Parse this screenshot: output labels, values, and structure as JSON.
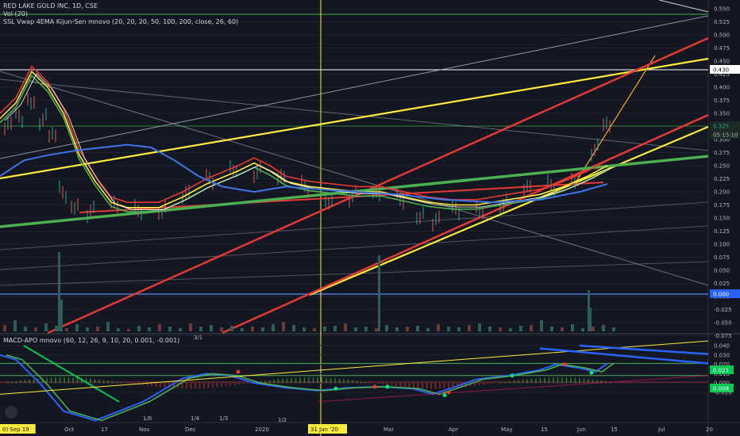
{
  "header": {
    "title": "RED LAKE GOLD INC, 1D, CSE",
    "vol_label": "Vol (20)",
    "indicator_label": "SSL Vwap 4EMA Kijun-Sen mnovo (20, 20, 20, 50, 100, 200, close, 26, 60)",
    "macd_label": "MACD-APO mnovo (60, 12, 26, 9, 10, 20, 0.001, -0.001)"
  },
  "price_axis": {
    "ticks": [
      "0.550",
      "0.525",
      "0.500",
      "0.475",
      "0.450",
      "0.425",
      "0.400",
      "0.375",
      "0.350",
      "0.325",
      "0.300",
      "0.275",
      "0.250",
      "0.225",
      "0.200",
      "0.175",
      "0.150",
      "0.125",
      "0.100",
      "0.075",
      "0.050",
      "0.025",
      "0.000",
      "-0.025",
      "-0.050",
      "-0.075"
    ],
    "markers": [
      {
        "label": "0.430",
        "bg": "#ffffff",
        "fg": "#131722"
      },
      {
        "label": "0.325",
        "bg": "#1b2a22",
        "fg": "#26a69a"
      },
      {
        "label": "05:15:10",
        "bg": "#1b2a22",
        "fg": "#b2b5be"
      },
      {
        "label": "0.000",
        "bg": "#2962ff",
        "fg": "#ffffff"
      }
    ]
  },
  "macd_axis": {
    "ticks": [
      "0.040",
      "0.030",
      "0.020",
      "0.010",
      "0.000",
      "-0.010"
    ],
    "markers": [
      {
        "label": "0.021",
        "bg": "#00c853",
        "fg": "#ffffff"
      },
      {
        "label": "0.008",
        "bg": "#00c853",
        "fg": "#ffffff"
      }
    ]
  },
  "time_axis": {
    "labels": [
      "0) Sep 19",
      "Oct",
      "17",
      "Nov",
      "Dec",
      "2020",
      "31 Jan '20",
      "Mar",
      "Apr",
      "May",
      "15",
      "Jun",
      "15",
      "Jul",
      "20"
    ],
    "highlight_labels": [
      "0) Sep 19",
      "31 Jan '20"
    ]
  },
  "fib_fan_labels": [
    "1/8",
    "1/4",
    "1/3",
    "1/2",
    "3/1"
  ],
  "colors": {
    "background": "#131722",
    "yellow_line": "#ffeb3b",
    "red_line": "#e53935",
    "green_line": "#4caf50",
    "blue_line": "#2962ff",
    "up_candle": "#26a69a",
    "down_candle": "#ef5350"
  },
  "chart_data": {
    "type": "line",
    "title": "RED LAKE GOLD INC, 1D, CSE",
    "x": [
      "Sep 19",
      "Oct",
      "Oct 17",
      "Nov",
      "Dec",
      "2020",
      "31 Jan '20",
      "Mar",
      "Apr",
      "May",
      "May 15",
      "Jun",
      "Jun 15",
      "Jul"
    ],
    "series": [
      {
        "name": "close",
        "values": [
          0.33,
          0.35,
          0.22,
          0.18,
          0.21,
          0.24,
          0.2,
          0.19,
          0.16,
          0.18,
          0.21,
          0.24,
          0.32,
          0.325
        ]
      }
    ],
    "ylim": [
      -0.075,
      0.55
    ],
    "last_price": 0.325,
    "countdown": "05:15:10",
    "macd_values": [
      0.01,
      -0.02,
      -0.03,
      -0.02,
      0.005,
      0.01,
      0.002,
      0.0,
      -0.005,
      0.002,
      0.012,
      0.018,
      0.021
    ]
  }
}
